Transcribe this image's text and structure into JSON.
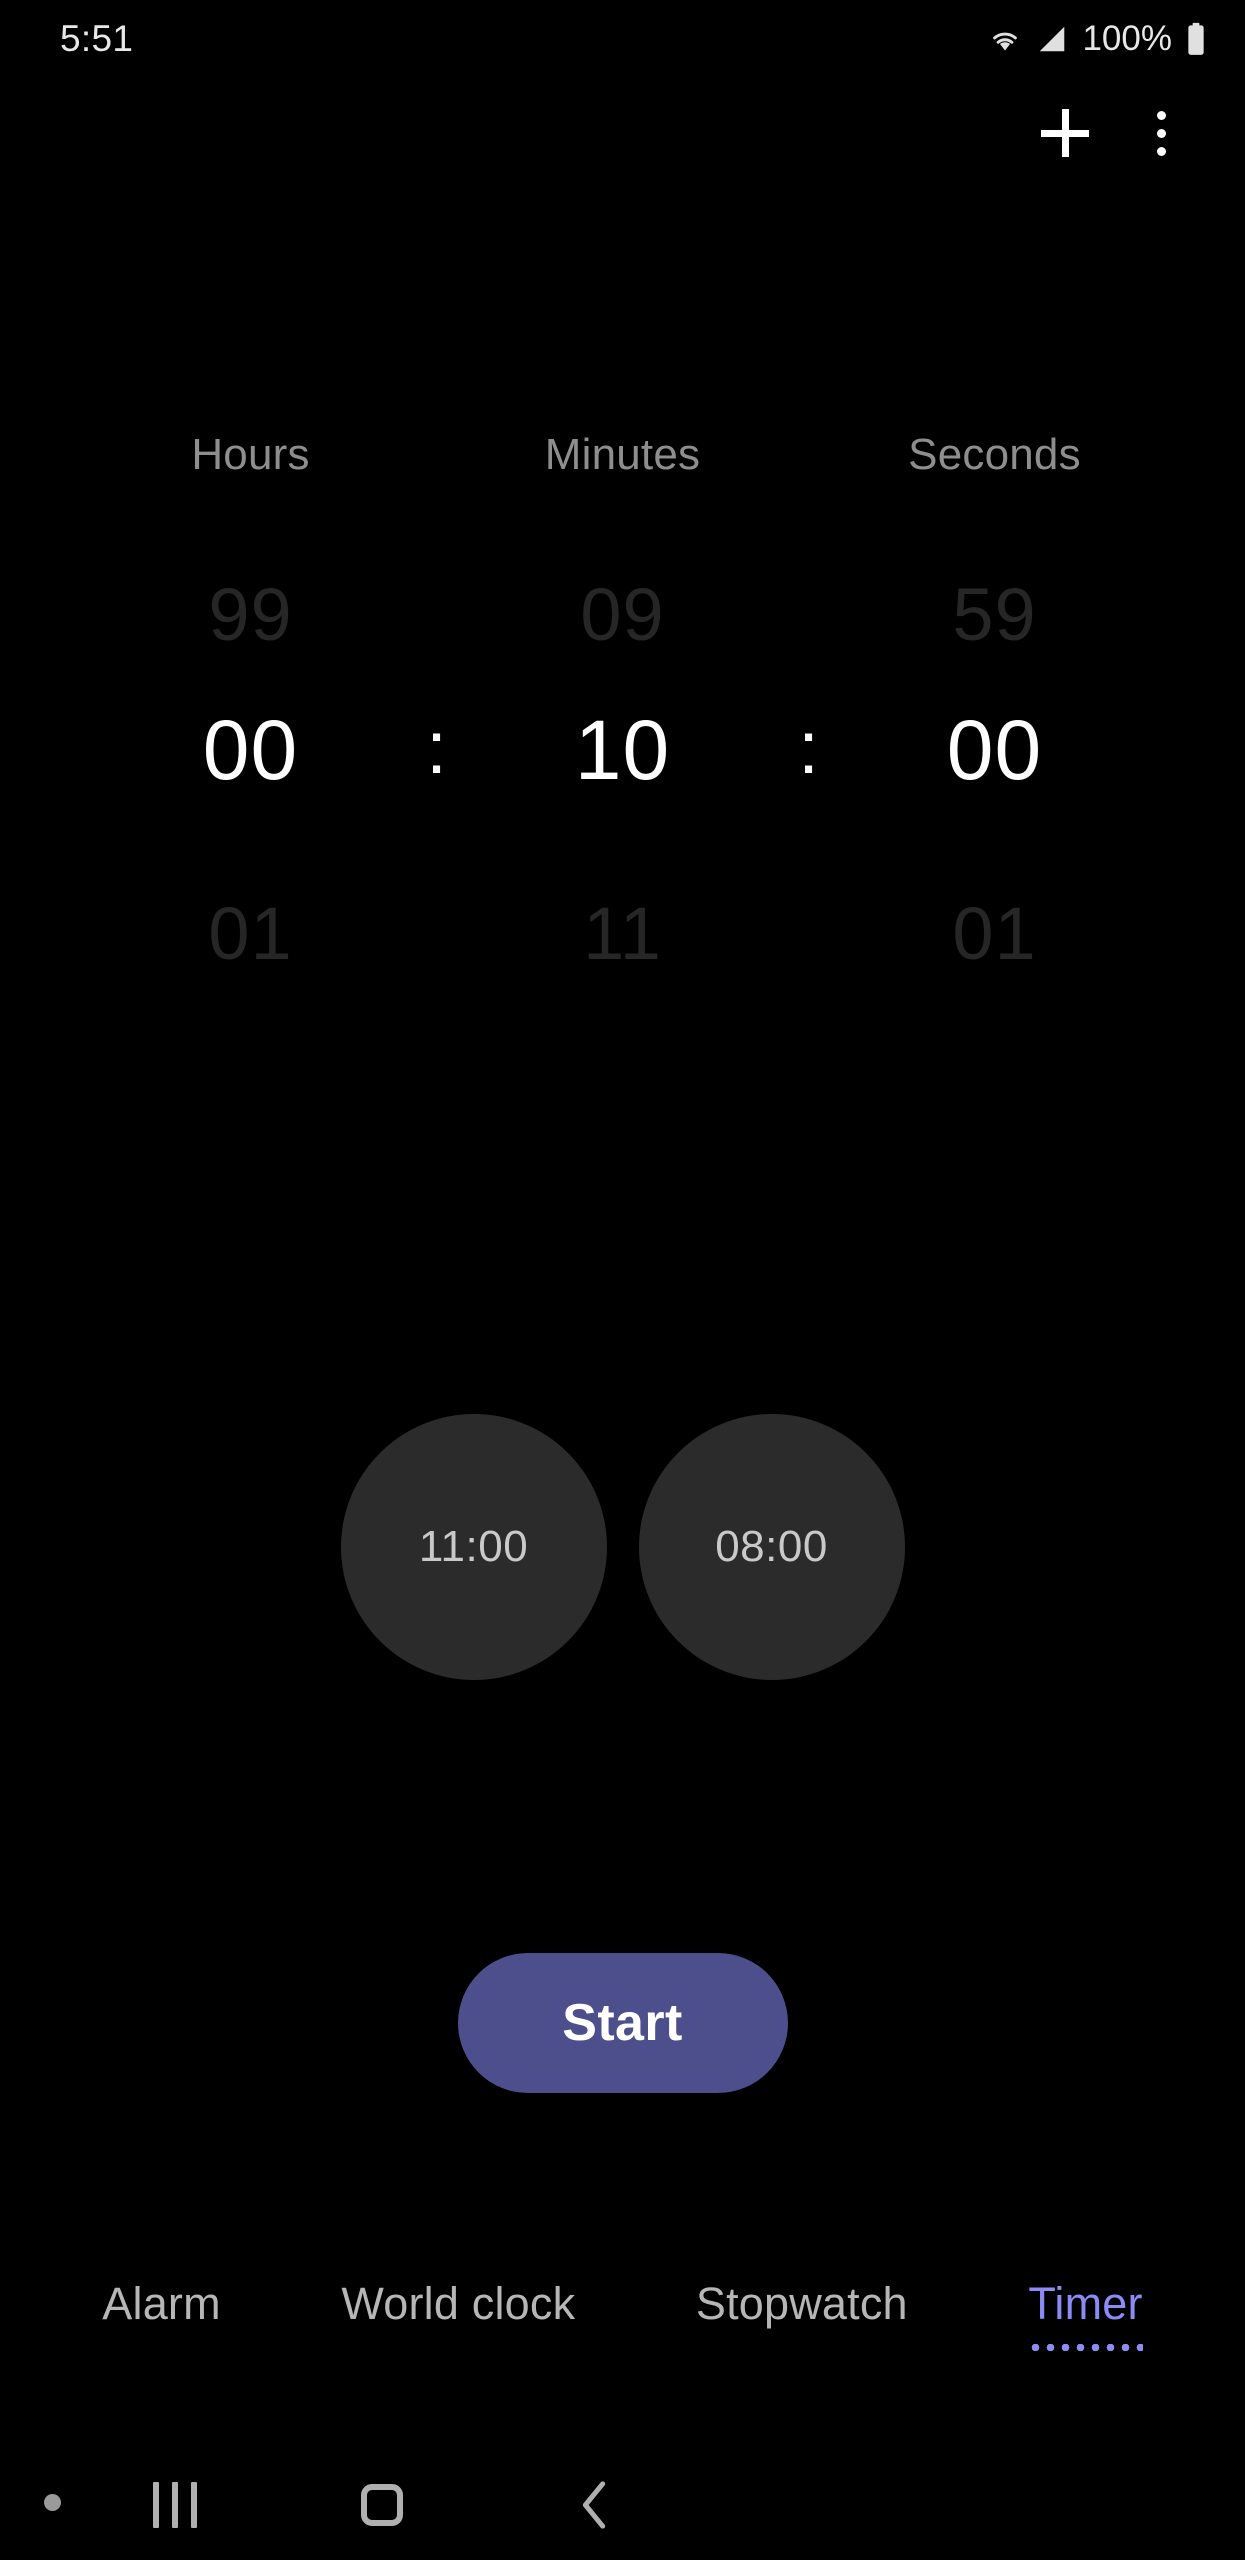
{
  "status_bar": {
    "time": "5:51",
    "battery_percent": "100%",
    "icons": [
      "wifi-icon",
      "signal-icon",
      "battery-icon"
    ]
  },
  "toolbar": {
    "add_label": "+",
    "add_icon": "plus-icon",
    "overflow_icon": "more-vert-icon"
  },
  "picker": {
    "labels": {
      "hours": "Hours",
      "minutes": "Minutes",
      "seconds": "Seconds"
    },
    "above": {
      "hours": "99",
      "minutes": "09",
      "seconds": "59"
    },
    "selected": {
      "hours": "00",
      "minutes": "10",
      "seconds": "00"
    },
    "below": {
      "hours": "01",
      "minutes": "11",
      "seconds": "01"
    },
    "separator": ":"
  },
  "presets": [
    {
      "label": "11:00"
    },
    {
      "label": "08:00"
    }
  ],
  "primary_action": {
    "label": "Start"
  },
  "tabs": [
    {
      "label": "Alarm",
      "active": false
    },
    {
      "label": "World clock",
      "active": false
    },
    {
      "label": "Stopwatch",
      "active": false
    },
    {
      "label": "Timer",
      "active": true
    }
  ],
  "nav_bar": {
    "recents_icon": "recents-icon",
    "home_icon": "home-icon",
    "back_icon": "back-icon",
    "indicator_icon": "dot-indicator-icon"
  },
  "colors": {
    "background": "#000000",
    "accent": "#4c4f8c",
    "active_tab": "#8b8bf5",
    "preset_circle": "#2b2b2b",
    "dim_text": "#262626",
    "label_text": "#8e8e8e"
  }
}
